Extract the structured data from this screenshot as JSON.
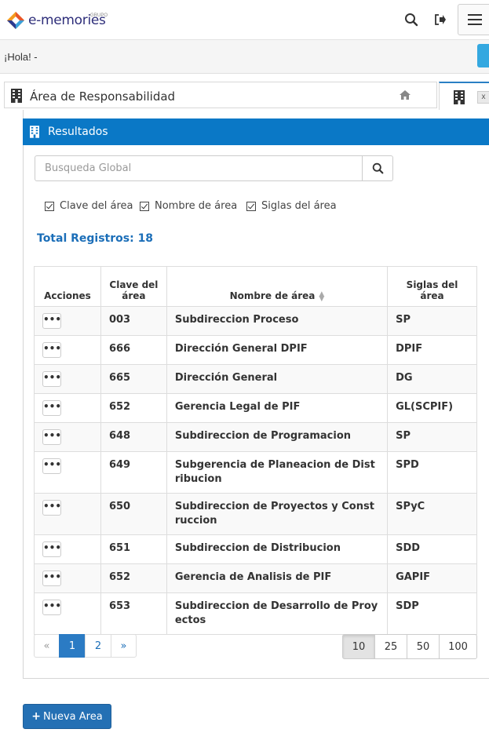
{
  "header": {
    "logo_text": "e-memories",
    "logo_sub": "GRUPO",
    "search_icon": "search-icon",
    "logout_icon": "sign-out-icon",
    "menu_icon": "hamburger-icon"
  },
  "greeting": "¡Hola! -",
  "tab": {
    "title": "Área de Responsabilidad",
    "building_icon": "building-icon",
    "home_icon": "home-icon",
    "close_label": "x"
  },
  "panel": {
    "title": "Resultados",
    "search_placeholder": "Busqueda Global",
    "filters": [
      "Clave del área",
      "Nombre de área",
      "Siglas del área"
    ],
    "total_label": "Total Registros: 18"
  },
  "table": {
    "headers": {
      "actions": "Acciones",
      "clave": "Clave del área",
      "nombre": "Nombre de área",
      "siglas": "Siglas del área"
    },
    "action_label": "•••",
    "rows": [
      {
        "clave": "003",
        "nombre": "Subdireccion Proceso",
        "siglas": "SP"
      },
      {
        "clave": "666",
        "nombre": "Dirección General DPIF",
        "siglas": "DPIF"
      },
      {
        "clave": "665",
        "nombre": "Dirección General",
        "siglas": "DG"
      },
      {
        "clave": "652",
        "nombre": "Gerencia Legal de PIF",
        "siglas": "GL(SCPIF)"
      },
      {
        "clave": "648",
        "nombre": "Subdireccion de Programacion",
        "siglas": "SP"
      },
      {
        "clave": "649",
        "nombre": "Subgerencia de Planeacion de Distribucion",
        "siglas": "SPD"
      },
      {
        "clave": "650",
        "nombre": "Subdireccion de Proyectos y Construccion",
        "siglas": "SPyC"
      },
      {
        "clave": "651",
        "nombre": "Subdireccion de Distribucion",
        "siglas": "SDD"
      },
      {
        "clave": "652",
        "nombre": "Gerencia de Analisis de PIF",
        "siglas": "GAPIF"
      },
      {
        "clave": "653",
        "nombre": "Subdireccion de Desarrollo de Proyectos",
        "siglas": "SDP"
      }
    ]
  },
  "pagination": {
    "prev": "«",
    "pages": [
      "1",
      "2"
    ],
    "next": "»",
    "current_page": 1
  },
  "page_sizes": [
    "10",
    "25",
    "50",
    "100"
  ],
  "selected_page_size": "10",
  "new_button_label": "Nueva Area",
  "colors": {
    "accent": "#0a78c6",
    "link": "#1b6eb8",
    "primary_button": "#2470b4"
  }
}
